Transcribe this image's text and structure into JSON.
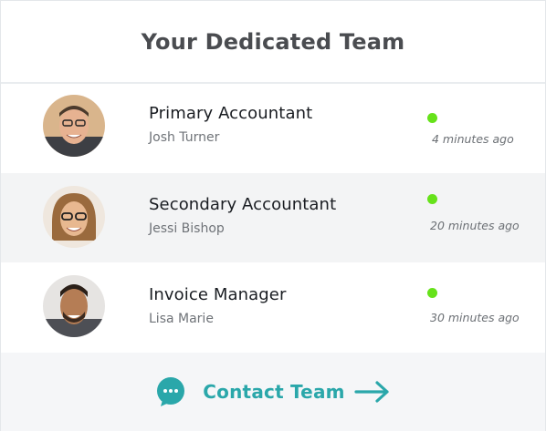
{
  "card": {
    "title": "Your Dedicated Team"
  },
  "colors": {
    "accent": "#2aa7aa",
    "online": "#66e21a",
    "alt_row": "#f3f4f5"
  },
  "team": [
    {
      "role": "Primary Accountant",
      "name": "Josh Turner",
      "last_seen": "4 minutes ago",
      "status": "online"
    },
    {
      "role": "Secondary Accountant",
      "name": "Jessi Bishop",
      "last_seen": "20 minutes ago",
      "status": "online"
    },
    {
      "role": "Invoice Manager",
      "name": "Lisa Marie",
      "last_seen": "30 minutes ago",
      "status": "online"
    }
  ],
  "footer": {
    "contact_label": "Contact Team",
    "icons": [
      "chat-bubble-icon",
      "arrow-right-icon"
    ]
  }
}
